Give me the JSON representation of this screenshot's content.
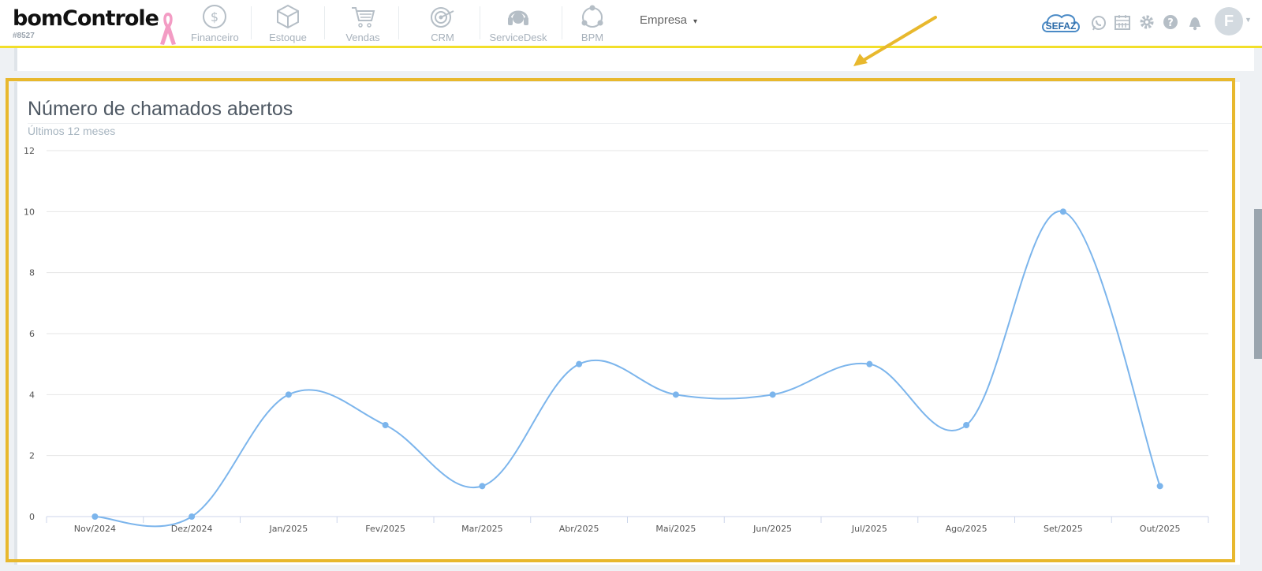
{
  "brand": {
    "logo_text": "bomControle",
    "account_id": "#8527"
  },
  "nav": {
    "items": [
      {
        "label": "Financeiro",
        "icon": "dollar-coin-icon"
      },
      {
        "label": "Estoque",
        "icon": "box-icon"
      },
      {
        "label": "Vendas",
        "icon": "shopping-cart-icon"
      },
      {
        "label": "CRM",
        "icon": "target-icon"
      },
      {
        "label": "ServiceDesk",
        "icon": "headset-icon"
      },
      {
        "label": "BPM",
        "icon": "process-cycle-icon"
      }
    ],
    "company_label": "Empresa",
    "company_caret": "▾"
  },
  "header_right": {
    "sefaz_label": "SEFAZ",
    "avatar_letter": "F",
    "icons": [
      "whatsapp-icon",
      "calendar-icon",
      "gear-icon",
      "help-icon",
      "bell-icon"
    ]
  },
  "colors": {
    "accent_yellow": "#f2df2a",
    "highlight_border": "#e8b82d",
    "series_line": "#7cb5ec",
    "ribbon_pink": "#f39cc4"
  },
  "chart_panel": {
    "title": "Número de chamados abertos",
    "subtitle": "Últimos 12 meses"
  },
  "chart_data": {
    "type": "line",
    "title": "Número de chamados abertos",
    "subtitle": "Últimos 12 meses",
    "categories": [
      "Nov/2024",
      "Dez/2024",
      "Jan/2025",
      "Fev/2025",
      "Mar/2025",
      "Abr/2025",
      "Mai/2025",
      "Jun/2025",
      "Jul/2025",
      "Ago/2025",
      "Set/2025",
      "Out/2025"
    ],
    "values": [
      0,
      0,
      4,
      3,
      1,
      5,
      4,
      4,
      5,
      3,
      10,
      1
    ],
    "ylim": [
      0,
      12
    ],
    "yticks": [
      0,
      2,
      4,
      6,
      8,
      10,
      12
    ],
    "grid": true,
    "smooth": true,
    "legend": "none"
  }
}
